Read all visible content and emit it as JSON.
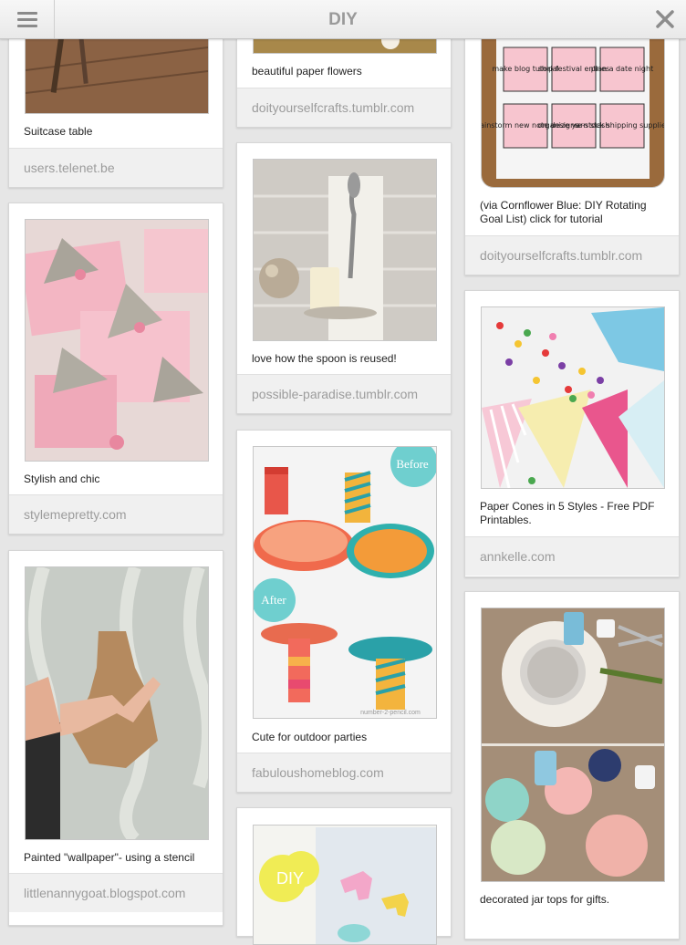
{
  "header": {
    "title": "DIY",
    "menu_icon": "hamburger-menu-icon",
    "close_icon": "close-icon"
  },
  "columns": [
    {
      "cards": [
        {
          "caption": "Suitcase table",
          "source": "users.telenet.be"
        },
        {
          "caption": "Stylish and chic",
          "source": "stylemepretty.com"
        },
        {
          "caption": "Painted \"wallpaper\"- using a stencil",
          "source": "littlenannygoat.blogspot.com"
        }
      ]
    },
    {
      "cards": [
        {
          "caption": "beautiful paper flowers",
          "source": "doityourselfcrafts.tumblr.com"
        },
        {
          "caption": "love how the spoon is reused!",
          "source": "possible-paradise.tumblr.com"
        },
        {
          "caption": "Cute for outdoor parties",
          "source": "fabuloushomeblog.com",
          "badges": [
            "Before",
            "After"
          ],
          "watermark": "number-2-pencil.com"
        },
        {
          "caption": "",
          "source": "",
          "image_text": "DIY"
        }
      ]
    },
    {
      "cards": [
        {
          "caption": "(via Cornflower Blue: DIY Rotating Goal List) click for tutorial",
          "source": "doityourselfcrafts.tumblr.com",
          "notes": [
            "make blog tutorial",
            "ship festival entries",
            "plan a date night",
            "brainstorm new note designs",
            "organize yarn stash",
            "re-stock shipping supplies"
          ]
        },
        {
          "caption": "Paper Cones in 5 Styles - Free PDF Printables.",
          "source": "annkelle.com"
        },
        {
          "caption": "decorated jar tops for gifts.",
          "source": ""
        }
      ]
    }
  ]
}
